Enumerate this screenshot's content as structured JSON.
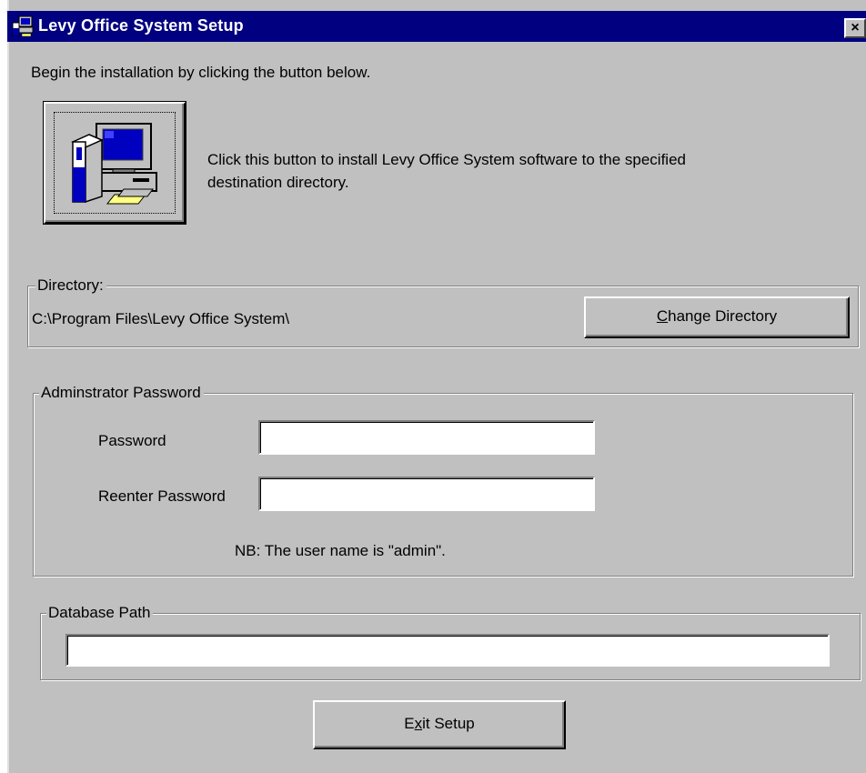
{
  "window": {
    "title": "Levy Office System Setup",
    "close_label": "×"
  },
  "intro": {
    "text": "Begin the installation by clicking the button below."
  },
  "install": {
    "description_line1": "Click this button to install Levy Office System software to the specified",
    "description_line2": "destination directory."
  },
  "directory": {
    "group_label": "Directory:",
    "path": "C:\\Program Files\\Levy Office System\\",
    "change_button": {
      "mnemonic": "C",
      "rest": "hange Directory"
    }
  },
  "admin": {
    "group_label": "Adminstrator Password",
    "password_label": "Password",
    "password_value": "",
    "reenter_label": "Reenter Password",
    "reenter_value": "",
    "note": "NB: The user name is \"admin\"."
  },
  "database": {
    "group_label": "Database Path",
    "path_value": ""
  },
  "exit_button": {
    "pre": "E",
    "mnemonic": "x",
    "rest": "it Setup"
  },
  "icons": {
    "title_icon": "setup-computer-icon",
    "install_icon": "install-computer-icon"
  },
  "colors": {
    "titlebar": "#000080",
    "face": "#c0c0c0"
  }
}
